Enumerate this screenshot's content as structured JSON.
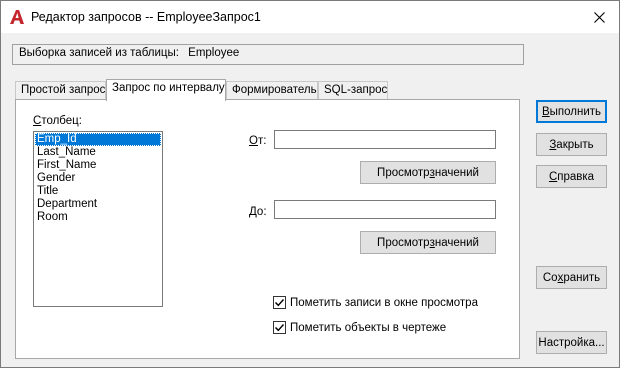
{
  "window": {
    "title": "Редактор запросов -- EmployeeЗапрос1",
    "app_icon": "autocad-a-icon",
    "close_icon": "close-icon"
  },
  "info": {
    "label": "Выборка записей из таблицы:",
    "table": "Employee"
  },
  "tabs": [
    {
      "label": "Простой запрос",
      "active": false
    },
    {
      "label": "Запрос по интервалу",
      "active": true
    },
    {
      "label": "Формирователь",
      "active": false
    },
    {
      "label": "SQL-запрос",
      "active": false
    }
  ],
  "range_query": {
    "column_label_u": "С",
    "column_label_rest": "толбец:",
    "columns": [
      "Emp_Id",
      "Last_Name",
      "First_Name",
      "Gender",
      "Title",
      "Department",
      "Room"
    ],
    "selected_column": "Emp_Id",
    "from_label_u": "О",
    "from_label_rest": "т:",
    "from_value": "",
    "to_label_u": "Д",
    "to_label_rest": "о:",
    "to_value": "",
    "view_values_from": {
      "before": "Просмотр ",
      "u": "з",
      "after": "начений"
    },
    "view_values_to": {
      "before": "Просмотр ",
      "u": "з",
      "after": "начений"
    },
    "mark_records": {
      "label": "Пометить записи в окне просмотра",
      "checked": true
    },
    "mark_objects": {
      "label": "Пометить объекты в чертеже",
      "checked": true
    }
  },
  "side_buttons": {
    "execute": {
      "u": "В",
      "rest": "ыполнить"
    },
    "close": {
      "u": "З",
      "rest": "акрыть"
    },
    "help": {
      "u": "С",
      "rest": "правка"
    },
    "save": {
      "before": "Со",
      "u": "х",
      "after": "ранить"
    },
    "settings": "Настройка..."
  },
  "colors": {
    "accent": "#0078d7",
    "app_icon_red": "#c4262e"
  }
}
